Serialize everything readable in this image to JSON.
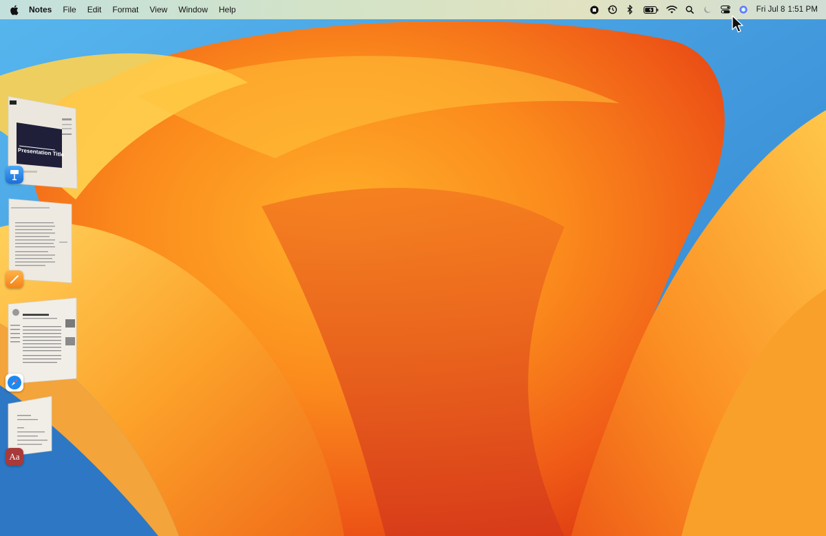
{
  "menubar": {
    "app_name": "Notes",
    "menus": [
      "File",
      "Edit",
      "Format",
      "View",
      "Window",
      "Help"
    ],
    "status_icons": [
      "screen-record-icon",
      "time-machine-icon",
      "bluetooth-icon",
      "battery-icon",
      "wifi-icon",
      "spotlight-icon",
      "focus-moon-icon",
      "control-center-icon",
      "siri-icon"
    ],
    "clock": {
      "date": "Fri Jul 8",
      "time": "1:51 PM"
    }
  },
  "stage_manager": {
    "keynote": {
      "slide_title": "Presentation Title",
      "badge_icon": "keynote-icon"
    },
    "pages": {
      "badge_icon": "pages-icon"
    },
    "safari": {
      "badge_icon": "safari-icon"
    },
    "dictionary": {
      "badge_label": "Aa",
      "badge_icon": "dictionary-icon"
    }
  },
  "colors": {
    "wallpaper_orange": "#f7941d",
    "wallpaper_blue": "#3f8fd6",
    "dictionary_badge": "#a83a3a"
  }
}
